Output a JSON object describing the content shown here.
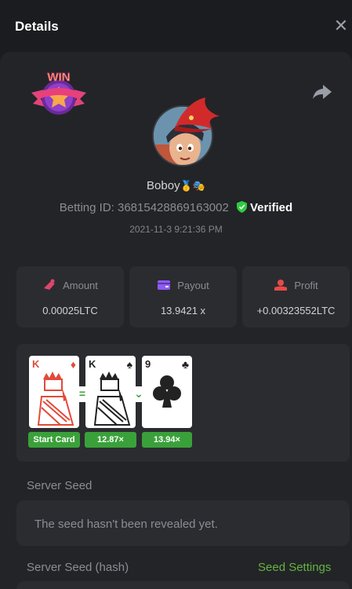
{
  "header": {
    "title": "Details",
    "close_glyph": "✕"
  },
  "badge": {
    "text": "WIN"
  },
  "user": {
    "name": "Boboy",
    "name_emoji": "🥇🎭",
    "betting_id_label": "Betting ID:",
    "betting_id": "36815428869163002",
    "verified_label": "Verified",
    "timestamp": "2021-11-3 9:21:36 PM"
  },
  "stats": [
    {
      "label": "Amount",
      "value": "0.00025LTC",
      "icon": "coin-icon",
      "color": "#e0456b"
    },
    {
      "label": "Payout",
      "value": "13.9421 x",
      "icon": "wallet-icon",
      "color": "#8e5cf0"
    },
    {
      "label": "Profit",
      "value": "+0.00323552LTC",
      "icon": "hand-coin-icon",
      "color": "#e84a4a"
    }
  ],
  "cards": [
    {
      "rank": "K",
      "suit": "♦",
      "color": "#e34a3a",
      "button": "Start Card"
    },
    {
      "rank": "K",
      "suit": "♠",
      "color": "#222222",
      "button": "12.87×",
      "op": "="
    },
    {
      "rank": "9",
      "suit": "♣",
      "color": "#222222",
      "button": "13.94×",
      "op": "⌄"
    }
  ],
  "server_seed": {
    "label": "Server Seed",
    "text": "The seed hasn't been revealed yet."
  },
  "server_seed_hash": {
    "label": "Server Seed (hash)",
    "settings_link": "Seed Settings"
  },
  "colors": {
    "accent_green": "#3aa13a",
    "link_green": "#62b440",
    "verified_green": "#2ecc40"
  }
}
